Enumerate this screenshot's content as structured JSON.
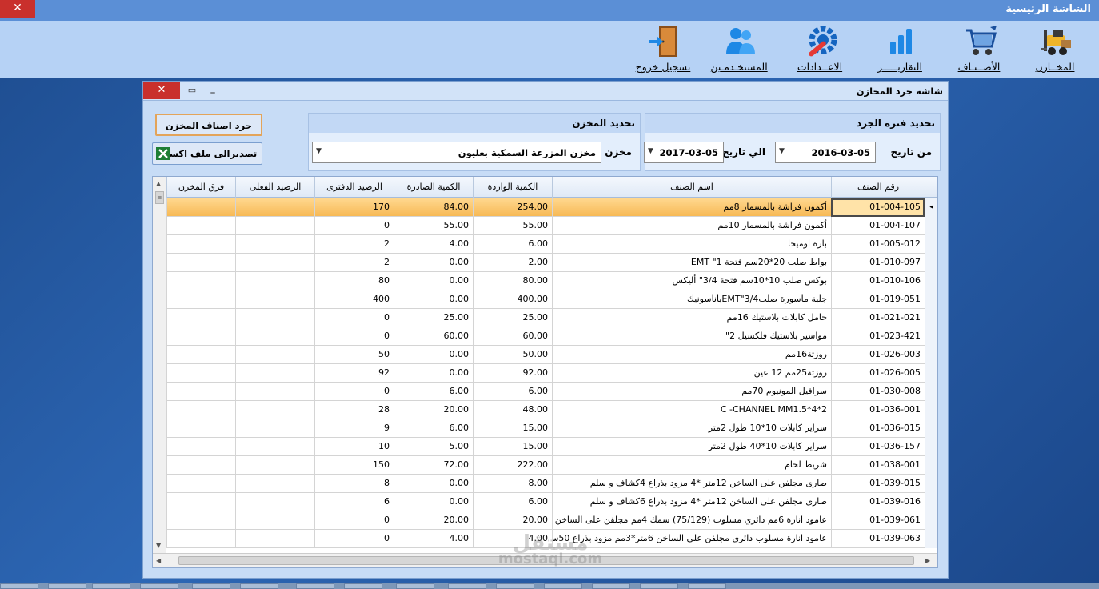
{
  "window": {
    "title": "الشاشة الرئيسية",
    "close_glyph": "✕"
  },
  "toolbar": {
    "items": [
      {
        "label": "المخــازن",
        "icon": "forklift-icon"
      },
      {
        "label": "الأصــنـاف",
        "icon": "cart-icon"
      },
      {
        "label": "التقاريـــــر",
        "icon": "bar-chart-icon"
      },
      {
        "label": "الاعــدادات",
        "icon": "wrench-gear-icon"
      },
      {
        "label": "المستخـدمـين",
        "icon": "users-icon"
      },
      {
        "label": "تسجيل خروج",
        "icon": "exit-door-icon"
      }
    ]
  },
  "child": {
    "title": "شاشة جرد المخازن",
    "close_glyph": "✕",
    "max_glyph": "▭",
    "min_glyph": "_",
    "period": {
      "header": "تحديد فترة الجرد",
      "from_label": "من تاريخ",
      "from_value": "2016-03-05",
      "to_label": "الي تاريخ",
      "to_value": "2017-03-05"
    },
    "store": {
      "header": "تحديد المخزن",
      "label": "مخزن",
      "value": "مخزن المزرعة السمكية بغليون"
    },
    "buttons": {
      "inventory": "جرد اصناف المخزن",
      "export": "تصديرالى ملف اكسيل"
    },
    "arrow_glyph": "▼"
  },
  "grid": {
    "columns": [
      "رقم الصنف",
      "اسم الصنف",
      "الكمية الواردة",
      "الكمية الصادرة",
      "الرصيد الدفترى",
      "الرصيد الفعلى",
      "فرق المخزن"
    ],
    "selected_marker": "◂",
    "rows": [
      [
        "01-004-105",
        "أكمون فراشة بالمسمار 8مم",
        "254.00",
        "84.00",
        "170"
      ],
      [
        "01-004-107",
        "أكمون فراشة بالمسمار 10مم",
        "55.00",
        "55.00",
        "0"
      ],
      [
        "01-005-012",
        "بارة اوميجا",
        "6.00",
        "4.00",
        "2"
      ],
      [
        "01-010-097",
        "بواط صلب 20*20سم فتحة 1\" EMT",
        "2.00",
        "0.00",
        "2"
      ],
      [
        "01-010-106",
        "بوكس صلب 10*10سم فتحة 3/4\" أليكس",
        "80.00",
        "0.00",
        "80"
      ],
      [
        "01-019-051",
        "جلبة ماسورة صلب3/4\"EMTباناسونيك",
        "400.00",
        "0.00",
        "400"
      ],
      [
        "01-021-021",
        "حامل كابلات بلاستيك 16مم",
        "25.00",
        "25.00",
        "0"
      ],
      [
        "01-023-421",
        "مواسير بلاستيك فلكسيل 2\"",
        "60.00",
        "60.00",
        "0"
      ],
      [
        "01-026-003",
        "روزتة16مم",
        "50.00",
        "0.00",
        "50"
      ],
      [
        "01-026-005",
        "روزتة25مم 12 عين",
        "92.00",
        "0.00",
        "92"
      ],
      [
        "01-030-008",
        "سرافيل المونيوم 70مم",
        "6.00",
        "6.00",
        "0"
      ],
      [
        "01-036-001",
        "C -CHANNEL MM1.5*4*2",
        "48.00",
        "20.00",
        "28"
      ],
      [
        "01-036-015",
        "سراير كابلات 10*10 طول 2متر",
        "15.00",
        "6.00",
        "9"
      ],
      [
        "01-036-157",
        "سراير كابلات 10*40 طول 2متر",
        "15.00",
        "5.00",
        "10"
      ],
      [
        "01-038-001",
        "شريط لحام",
        "222.00",
        "72.00",
        "150"
      ],
      [
        "01-039-015",
        "صارى مجلفن على الساخن 12متر *4 مزود بذراع 4كشاف و سلم",
        "8.00",
        "0.00",
        "8"
      ],
      [
        "01-039-016",
        "صارى مجلفن على الساخن 12متر *4 مزود بذراع 6كشاف و سلم",
        "6.00",
        "0.00",
        "6"
      ],
      [
        "01-039-061",
        "عامود انارة 6مم دائري مسلوب (75/129) سمك 4مم مجلفن على الساخن ب...",
        "20.00",
        "20.00",
        "0"
      ],
      [
        "01-039-063",
        "عامود انارة مسلوب دائرى مجلفن على الساخن 6متر*3مم مزود بذراع 50س...",
        "4.00",
        "4.00",
        "0"
      ]
    ]
  },
  "watermark": {
    "ar": "مستقل",
    "lat": "mostaql.com"
  },
  "colors": {
    "selected_row": "#f7b955",
    "accent": "#5b8fd6",
    "close": "#c9302c"
  }
}
